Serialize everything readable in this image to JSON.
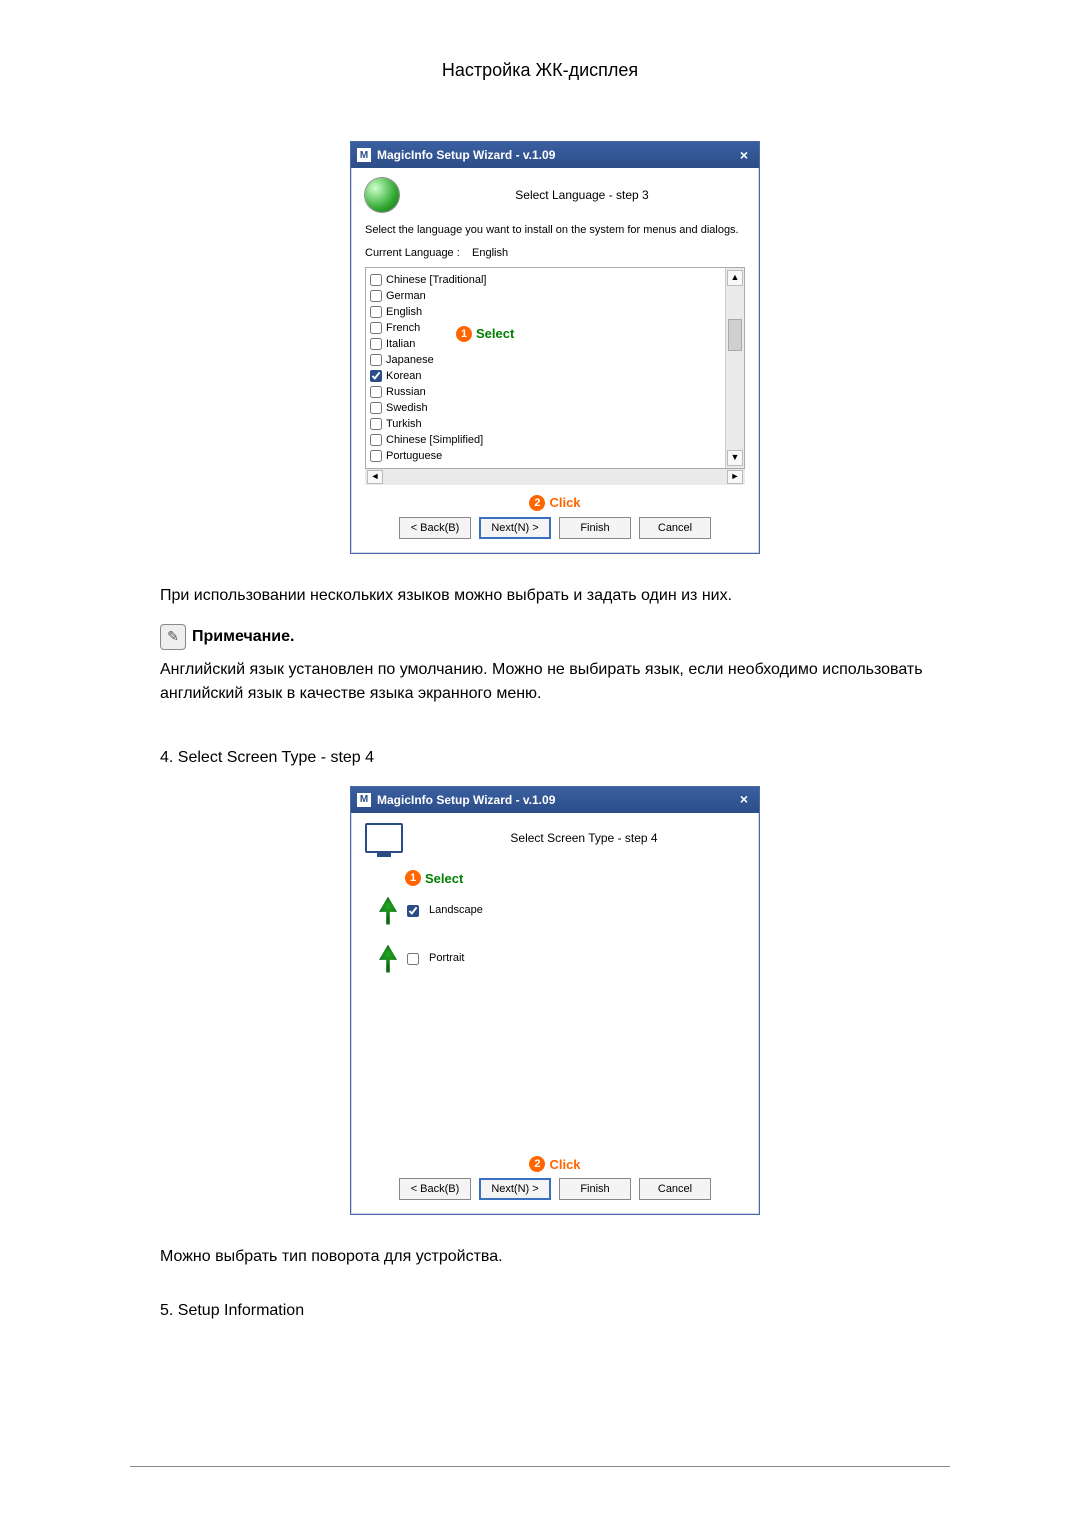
{
  "page_title": "Настройка ЖК-дисплея",
  "wizard_title": "MagicInfo Setup Wizard - v.1.09",
  "step3": {
    "header": "Select Language - step 3",
    "instruction": "Select the language you want to install on the system for menus and dialogs.",
    "current_language_label": "Current Language  :",
    "current_language_value": "English",
    "languages": [
      {
        "name": "Chinese [Traditional]",
        "checked": false
      },
      {
        "name": "German",
        "checked": false
      },
      {
        "name": "English",
        "checked": false
      },
      {
        "name": "French",
        "checked": false
      },
      {
        "name": "Italian",
        "checked": false
      },
      {
        "name": "Japanese",
        "checked": false
      },
      {
        "name": "Korean",
        "checked": true
      },
      {
        "name": "Russian",
        "checked": false
      },
      {
        "name": "Swedish",
        "checked": false
      },
      {
        "name": "Turkish",
        "checked": false
      },
      {
        "name": "Chinese [Simplified]",
        "checked": false
      },
      {
        "name": "Portuguese",
        "checked": false
      }
    ]
  },
  "callouts": {
    "select_badge": "1",
    "select_text": "Select",
    "click_badge": "2",
    "click_text": "Click"
  },
  "buttons": {
    "back": "< Back(B)",
    "next": "Next(N) >",
    "finish": "Finish",
    "cancel": "Cancel"
  },
  "text_after_step3": "При использовании нескольких языков можно выбрать и задать один из них.",
  "note_label": "Примечание.",
  "note_text": "Английский язык установлен по умолчанию. Можно не выбирать язык, если необходимо использовать английский язык в качестве языка экранного меню.",
  "step4_heading": "4. Select Screen Type - step 4",
  "step4": {
    "header": "Select Screen Type - step 4",
    "options": [
      {
        "label": "Landscape",
        "checked": true
      },
      {
        "label": "Portrait",
        "checked": false
      }
    ]
  },
  "text_after_step4": "Можно выбрать тип поворота для устройства.",
  "step5_heading": "5. Setup Information"
}
